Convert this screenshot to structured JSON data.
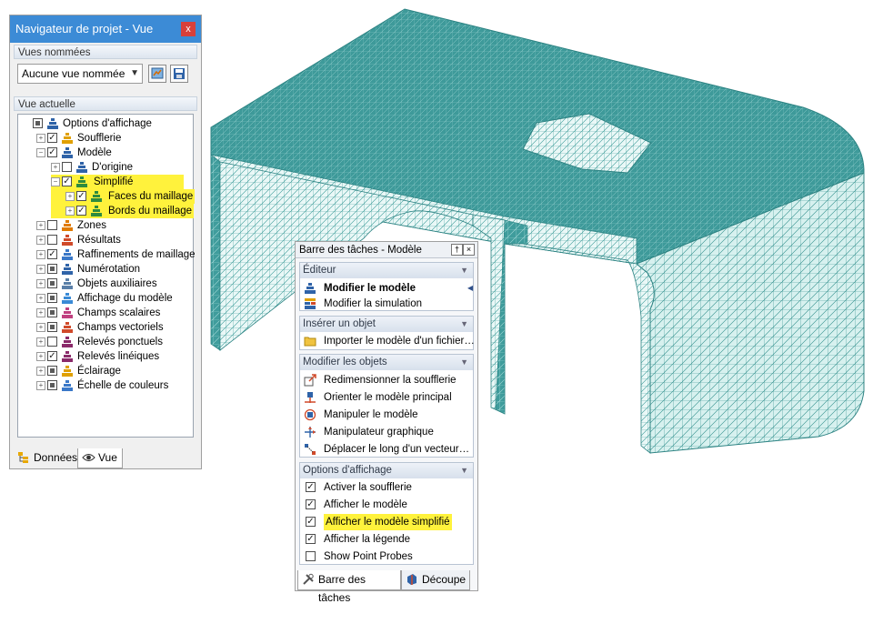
{
  "navigator": {
    "title": "Navigateur de projet - Vue",
    "close_label": "x",
    "named_views": {
      "heading": "Vues nommées",
      "selected": "Aucune vue nommée"
    },
    "current_view": {
      "heading": "Vue actuelle",
      "items": [
        {
          "label": "Options d'affichage",
          "icon": "eye-icon",
          "checked": "partial"
        },
        {
          "label": "Soufflerie",
          "icon": "wind-tunnel-icon",
          "checked": "checked"
        },
        {
          "label": "Modèle",
          "icon": "model-icon",
          "checked": "checked"
        },
        {
          "label": "D'origine",
          "icon": "model-icon",
          "checked": "unchecked"
        },
        {
          "label": "Simplifié",
          "icon": "simplified-model-icon",
          "checked": "checked",
          "highlight": true
        },
        {
          "label": "Faces du maillage",
          "icon": "mesh-faces-icon",
          "checked": "checked",
          "highlight": true
        },
        {
          "label": "Bords du maillage",
          "icon": "mesh-edges-icon",
          "checked": "checked",
          "highlight": true
        },
        {
          "label": "Zones",
          "icon": "zones-icon",
          "checked": "unchecked"
        },
        {
          "label": "Résultats",
          "icon": "results-icon",
          "checked": "unchecked"
        },
        {
          "label": "Raffinements de maillage",
          "icon": "mesh-refinement-icon",
          "checked": "checked"
        },
        {
          "label": "Numérotation",
          "icon": "numbering-icon",
          "checked": "partial"
        },
        {
          "label": "Objets auxiliaires",
          "icon": "auxiliary-objects-icon",
          "checked": "partial"
        },
        {
          "label": "Affichage du modèle",
          "icon": "model-display-icon",
          "checked": "partial"
        },
        {
          "label": "Champs scalaires",
          "icon": "scalar-fields-icon",
          "checked": "partial"
        },
        {
          "label": "Champs vectoriels",
          "icon": "vector-fields-icon",
          "checked": "partial"
        },
        {
          "label": "Relevés ponctuels",
          "icon": "point-probes-icon",
          "checked": "unchecked"
        },
        {
          "label": "Relevés linéiques",
          "icon": "line-probes-icon",
          "checked": "checked"
        },
        {
          "label": "Éclairage",
          "icon": "lighting-icon",
          "checked": "partial"
        },
        {
          "label": "Échelle de couleurs",
          "icon": "color-scale-icon",
          "checked": "partial"
        }
      ]
    },
    "tabs": [
      {
        "label": "Données",
        "icon": "data-tree-icon"
      },
      {
        "label": "Vue",
        "icon": "eye-icon"
      }
    ]
  },
  "taskbar": {
    "title": "Barre des tâches - Modèle",
    "groups": [
      {
        "heading": "Éditeur",
        "items": [
          {
            "label": "Modifier le modèle",
            "icon": "model-icon",
            "bold": true
          },
          {
            "label": "Modifier la simulation",
            "icon": "simulation-icon",
            "bold": false
          }
        ]
      },
      {
        "heading": "Insérer un objet",
        "items": [
          {
            "label": "Importer le modèle d'un fichier…",
            "icon": "folder-icon",
            "bold": false
          }
        ]
      },
      {
        "heading": "Modifier les objets",
        "items": [
          {
            "label": "Redimensionner la soufflerie",
            "icon": "resize-icon",
            "bold": false
          },
          {
            "label": "Orienter le modèle principal",
            "icon": "orient-icon",
            "bold": false
          },
          {
            "label": "Manipuler le modèle",
            "icon": "manipulate-icon",
            "bold": false
          },
          {
            "label": "Manipulateur graphique",
            "icon": "graphic-manipulator-icon",
            "bold": false
          },
          {
            "label": "Déplacer le long d'un vecteur…",
            "icon": "move-vector-icon",
            "bold": false
          }
        ]
      },
      {
        "heading": "Options d'affichage",
        "items": [
          {
            "label": "Activer la soufflerie",
            "checked": true
          },
          {
            "label": "Afficher le modèle",
            "checked": true
          },
          {
            "label": "Afficher le modèle simplifié",
            "checked": true,
            "highlight": true
          },
          {
            "label": "Afficher la légende",
            "checked": true
          },
          {
            "label": "Show Point Probes",
            "checked": false
          }
        ]
      }
    ],
    "tabs": [
      {
        "label": "Barre des tâches",
        "icon": "tools-icon"
      },
      {
        "label": "Découpe",
        "icon": "clipping-icon"
      }
    ]
  },
  "colors": {
    "titlebar": "#3c8bd6",
    "mesh_fill": "#3f9c9c",
    "mesh_lines": "#c9f0ee",
    "highlight": "#fff23c"
  }
}
